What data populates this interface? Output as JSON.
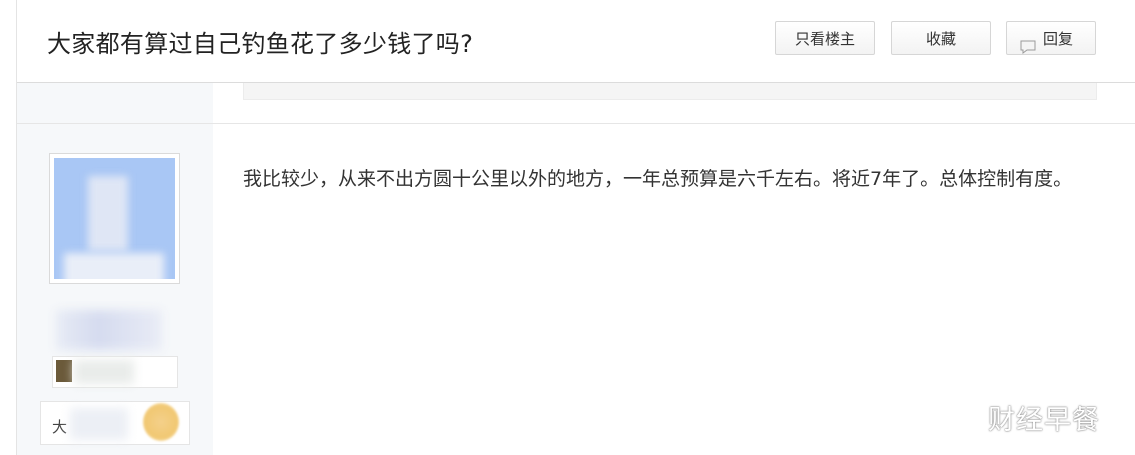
{
  "thread": {
    "title": "大家都有算过自己钓鱼花了多少钱了吗?"
  },
  "toolbar": {
    "only_op_label": "只看楼主",
    "favorite_label": "收藏",
    "reply_label": "回复"
  },
  "post": {
    "content": "我比较少，从来不出方圆十公里以外的地方，一年总预算是六千左右。将近7年了。总体控制有度。",
    "author": {
      "rank_prefix": "大"
    }
  },
  "watermark": {
    "text": "财经早餐"
  },
  "colors": {
    "author_panel_bg": "#f6f8fa",
    "avatar_bg": "#a9c7f5",
    "border": "#dcdcdc"
  }
}
